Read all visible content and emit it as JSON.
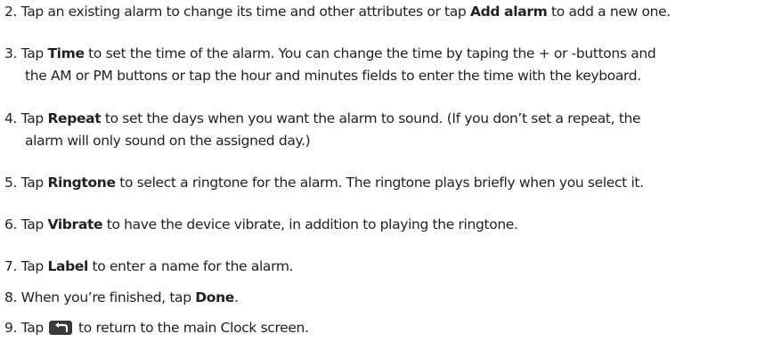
{
  "steps": [
    {
      "n": "2.",
      "parts": [
        "Tap an existing alarm to change its time and other attributes or tap ",
        "Add alarm",
        " to add a new one."
      ]
    },
    {
      "n": "3.",
      "parts": [
        "Tap ",
        "Time",
        " to set the time of the alarm. You can change the time by taping the + or -buttons and"
      ],
      "cont": "the AM or PM buttons or tap the hour and minutes fields to enter the time with the keyboard."
    },
    {
      "n": "4.",
      "parts": [
        "Tap ",
        "Repeat",
        " to set the days when you want the alarm to sound. (If you don’t set a repeat, the"
      ],
      "cont": "alarm will only sound on the assigned day.)"
    },
    {
      "n": "5.",
      "parts": [
        "Tap ",
        "Ringtone",
        " to select a ringtone for the alarm. The ringtone plays briefly when you select it."
      ]
    },
    {
      "n": "6.",
      "parts": [
        "Tap ",
        "Vibrate",
        " to have the device vibrate, in addition to playing the ringtone."
      ]
    },
    {
      "n": "7.",
      "parts": [
        "Tap ",
        "Label",
        " to enter a name for the alarm."
      ]
    },
    {
      "n": "8.",
      "parts": [
        "When you’re finished, tap ",
        "Done",
        "."
      ]
    },
    {
      "n": "9.",
      "parts": [
        "Tap ",
        "",
        " to return to the main Clock screen."
      ],
      "icon": "back-arrow-icon"
    }
  ],
  "colors": {
    "text": "#231f20",
    "icon_bg": "#3a3a3a",
    "icon_arrow": "#ffffff"
  }
}
